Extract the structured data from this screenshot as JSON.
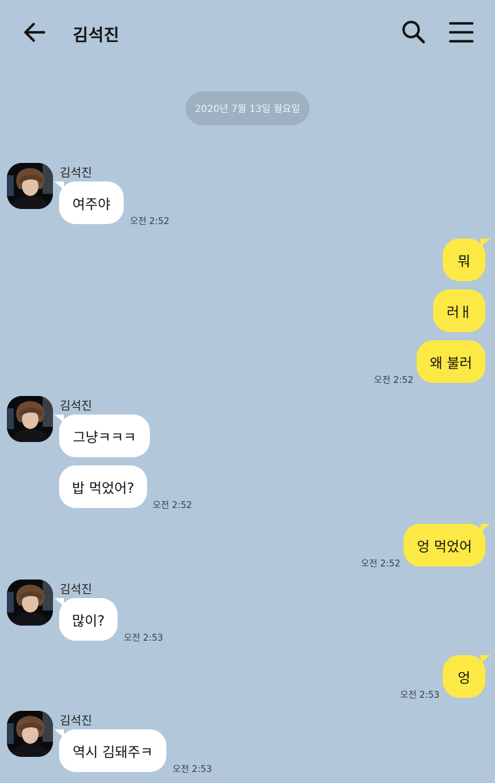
{
  "header": {
    "title": "김석진"
  },
  "date_divider": "2020년 7월 13일 월요일",
  "sender_name": "김석진",
  "messages": [
    {
      "text": "여주야",
      "time": "오전 2:52"
    },
    {
      "text": "뭐"
    },
    {
      "text": "러ㅐ"
    },
    {
      "text": "왜 불러",
      "time": "오전 2:52"
    },
    {
      "text": "그냥ㅋㅋㅋ"
    },
    {
      "text": "밥 먹었어?",
      "time": "오전 2:52"
    },
    {
      "text": "엉 먹었어",
      "time": "오전 2:52"
    },
    {
      "text": "많이?",
      "time": "오전 2:53"
    },
    {
      "text": "엉",
      "time": "오전 2:53"
    },
    {
      "text": "역시 김돼주ㅋ",
      "time": "오전 2:53"
    }
  ],
  "colors": {
    "background": "#b2c7da",
    "outgoing": "#fde945",
    "incoming": "#ffffff"
  },
  "icons": [
    "back-arrow-icon",
    "search-icon",
    "menu-icon",
    "avatar"
  ]
}
